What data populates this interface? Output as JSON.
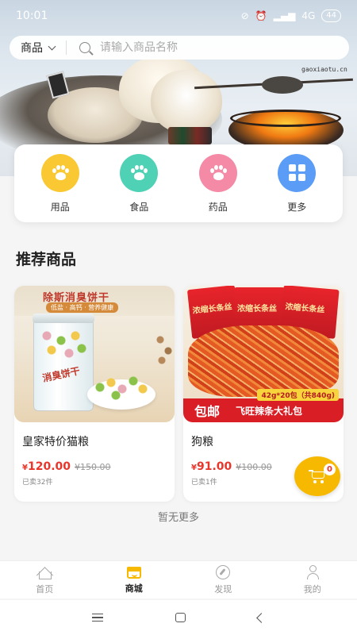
{
  "status_bar": {
    "time": "10:01",
    "signal": "4G",
    "battery": "44"
  },
  "hero": {
    "watermark": "gaoxiaotu.cn"
  },
  "search": {
    "category": "商品",
    "placeholder": "请输入商品名称"
  },
  "categories": [
    {
      "label": "用品",
      "color": "#f9c832",
      "icon": "paw-icon"
    },
    {
      "label": "食品",
      "color": "#4fd1b5",
      "icon": "paw-icon"
    },
    {
      "label": "药品",
      "color": "#f48aa5",
      "icon": "paw-icon"
    },
    {
      "label": "更多",
      "color": "#5b9cf6",
      "icon": "grid-icon"
    }
  ],
  "section_title": "推荐商品",
  "products": [
    {
      "name": "皇家特价猫粮",
      "price": "120.00",
      "original_price": "¥150.00",
      "sold": "已卖32件",
      "image_text": {
        "title": "除斯消臭饼干",
        "subtitle": "低盐 · 高钙 · 营养健康",
        "jar_label": "消臭饼干"
      }
    },
    {
      "name": "狗粮",
      "price": "91.00",
      "original_price": "¥100.00",
      "sold": "已卖1件",
      "image_text": {
        "pkg": "浓缩长条丝",
        "free_shipping": "包邮",
        "pack": "42g*20包（共840g)",
        "promo": "飞旺辣条大礼包"
      }
    }
  ],
  "currency_symbol": "¥",
  "cart": {
    "count": "0"
  },
  "no_more_text": "暂无更多",
  "tabbar": [
    {
      "label": "首页",
      "icon": "home-icon",
      "active": false
    },
    {
      "label": "商城",
      "icon": "shop-icon",
      "active": true
    },
    {
      "label": "发现",
      "icon": "compass-icon",
      "active": false
    },
    {
      "label": "我的",
      "icon": "user-icon",
      "active": false
    }
  ],
  "colors": {
    "accent": "#f7b900",
    "price": "#e8362b"
  }
}
